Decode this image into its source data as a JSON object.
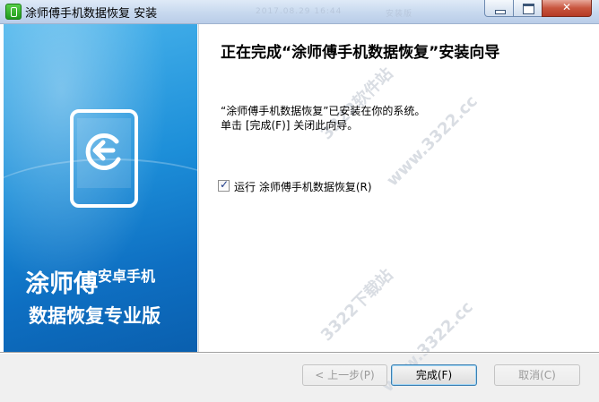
{
  "window": {
    "title": "涂师傅手机数据恢复 安装",
    "title_faded_1": "2017.08.29 16:44",
    "title_faded_2": "安装版"
  },
  "banner": {
    "line1_main": "涂师傅",
    "line1_small": "安卓手机",
    "line2": "数据恢复专业版",
    "background_color": "#1d8fd9"
  },
  "page": {
    "heading": "正在完成“涂师傅手机数据恢复”安装向导",
    "desc_line1": "“涂师傅手机数据恢复”已安装在你的系统。",
    "desc_line2": "单击 [完成(F)] 关闭此向导。",
    "run_checkbox": {
      "label": "运行 涂师傅手机数据恢复(R)",
      "checked": true
    }
  },
  "watermark": {
    "text1": "3322软件站",
    "text2": "www.3322.cc",
    "text3": "3322下载站",
    "text4": "www.3322.cc"
  },
  "buttons": {
    "back": "< 上一步(P)",
    "finish": "完成(F)",
    "cancel": "取消(C)"
  },
  "icons": [
    "app-icon",
    "phone-icon",
    "back-arrow-icon",
    "minimize-icon",
    "maximize-icon",
    "close-icon",
    "checkmark-icon"
  ]
}
